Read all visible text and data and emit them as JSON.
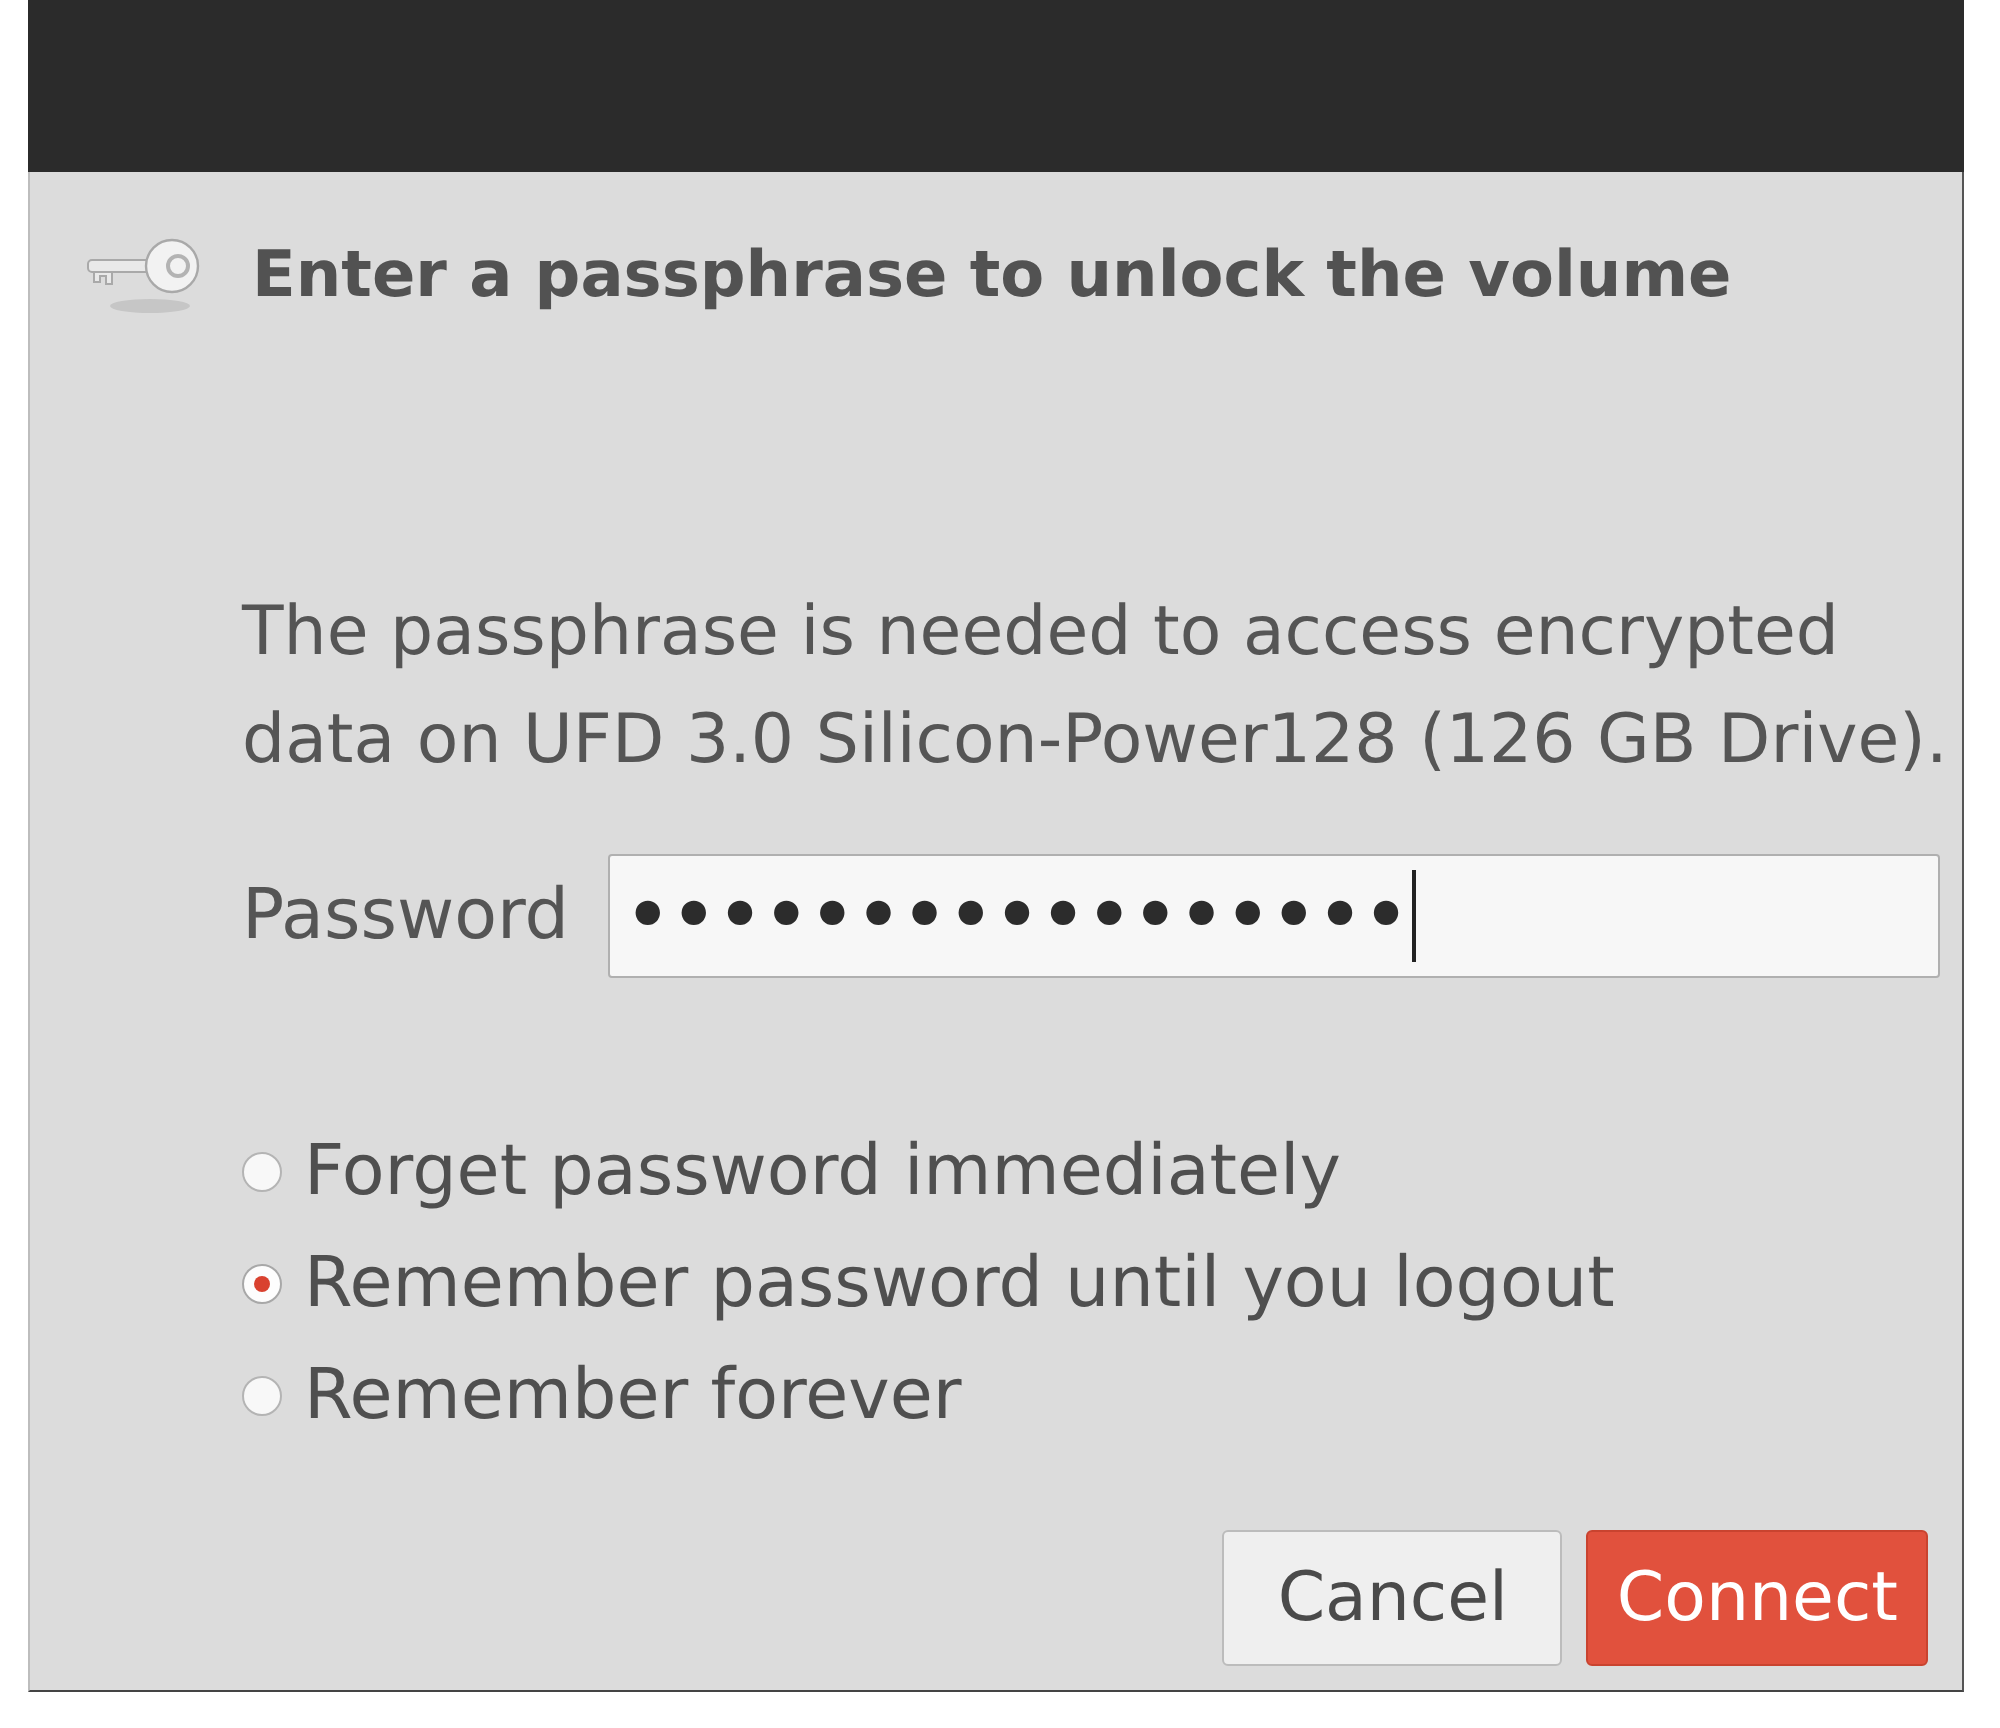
{
  "dialog": {
    "heading": "Enter a passphrase to unlock the volume",
    "message": "The passphrase is needed to access encrypted data on UFD 3.0 Silicon-Power128 (126 GB Drive).",
    "password": {
      "label": "Password",
      "value": "•••••••••••••••••",
      "focused": true
    },
    "remember_options": [
      {
        "label": "Forget password immediately",
        "selected": false
      },
      {
        "label": "Remember password until you logout",
        "selected": true
      },
      {
        "label": "Remember forever",
        "selected": false
      }
    ],
    "buttons": [
      {
        "label": "Cancel",
        "kind": "cancel"
      },
      {
        "label": "Connect",
        "kind": "suggested"
      }
    ]
  }
}
